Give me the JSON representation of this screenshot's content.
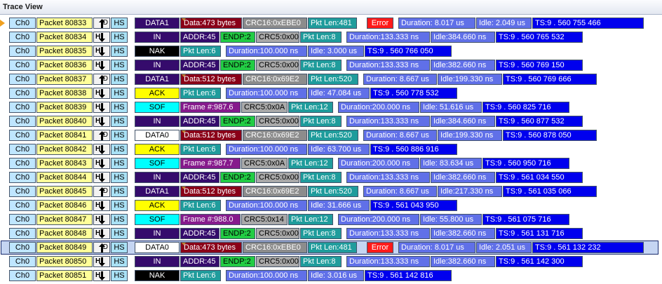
{
  "window": {
    "title": "Trace View"
  },
  "rows": [
    {
      "ch": "Ch0",
      "packet": "Packet 80833",
      "dir": "out",
      "dirLabel": "D",
      "hs": "HS",
      "pid": "DATA1",
      "pidType": "dark",
      "fields": [
        {
          "t": "dat",
          "text": "Data:473 bytes",
          "w": 88
        },
        {
          "t": "crc16",
          "text": "CRC16:0xEBE0",
          "w": 92
        },
        {
          "t": "plen",
          "text": "Pkt Len:481",
          "w": 70
        },
        {
          "t": "err",
          "text": "Error",
          "w": 38,
          "gap": 13
        },
        {
          "t": "dur",
          "text": "Duration:  8.017 us",
          "w": 110,
          "gap": 6
        },
        {
          "t": "idle",
          "text": "Idle:  2.049 us",
          "w": 79
        },
        {
          "t": "ts",
          "text": "TS:9 . 560 755 466",
          "w": 159
        }
      ]
    },
    {
      "ch": "Ch0",
      "packet": "Packet 80834",
      "dir": "in",
      "dirLabel": "H",
      "hs": "HS",
      "pid": "IN",
      "pidType": "dark",
      "fields": [
        {
          "t": "addr",
          "text": "ADDR:45",
          "w": 56
        },
        {
          "t": "endp",
          "text": "ENDP:2",
          "w": 50
        },
        {
          "t": "crc5",
          "text": "CRC5:0x00",
          "w": 62
        },
        {
          "t": "plen",
          "text": "Pkt Len:8",
          "w": 59
        },
        {
          "t": "dur",
          "text": "Duration:133.333 ns",
          "w": 119,
          "gap": 6
        },
        {
          "t": "idle",
          "text": "Idle:384.660 ns",
          "w": 92
        },
        {
          "t": "ts",
          "text": "TS:9 . 560 765 532",
          "w": 124
        }
      ]
    },
    {
      "ch": "Ch0",
      "packet": "Packet 80835",
      "dir": "in",
      "dirLabel": "H",
      "hs": "HS",
      "pid": "NAK",
      "pidType": "nak",
      "fields": [
        {
          "t": "plen",
          "text": "Pkt Len:6",
          "w": 58
        },
        {
          "t": "dur",
          "text": "Duration:100.000 ns",
          "w": 116,
          "gap": 6
        },
        {
          "t": "idle",
          "text": "Idle:  3.000 us",
          "w": 80
        },
        {
          "t": "ts",
          "text": "TS:9 . 560 766 050",
          "w": 124
        }
      ]
    },
    {
      "ch": "Ch0",
      "packet": "Packet 80836",
      "dir": "in",
      "dirLabel": "H",
      "hs": "HS",
      "pid": "IN",
      "pidType": "dark",
      "fields": [
        {
          "t": "addr",
          "text": "ADDR:45",
          "w": 56
        },
        {
          "t": "endp",
          "text": "ENDP:2",
          "w": 50
        },
        {
          "t": "crc5",
          "text": "CRC5:0x00",
          "w": 62
        },
        {
          "t": "plen",
          "text": "Pkt Len:8",
          "w": 59
        },
        {
          "t": "dur",
          "text": "Duration:133.333 ns",
          "w": 119,
          "gap": 6
        },
        {
          "t": "idle",
          "text": "Idle:382.660 ns",
          "w": 92
        },
        {
          "t": "ts",
          "text": "TS:9 . 560 769 150",
          "w": 124
        }
      ]
    },
    {
      "ch": "Ch0",
      "packet": "Packet 80837",
      "dir": "out",
      "dirLabel": "D",
      "hs": "HS",
      "pid": "DATA1",
      "pidType": "dark",
      "fields": [
        {
          "t": "dat",
          "text": "Data:512 bytes",
          "w": 88
        },
        {
          "t": "crc16",
          "text": "CRC16:0x69E2",
          "w": 92
        },
        {
          "t": "plen",
          "text": "Pkt Len:520",
          "w": 72
        },
        {
          "t": "dur",
          "text": "Duration:  8.667 us",
          "w": 105,
          "gap": 6
        },
        {
          "t": "idle",
          "text": "Idle:199.330 ns",
          "w": 92
        },
        {
          "t": "ts",
          "text": "TS:9 . 560 769 666",
          "w": 134
        }
      ]
    },
    {
      "ch": "Ch0",
      "packet": "Packet 80838",
      "dir": "in",
      "dirLabel": "H",
      "hs": "HS",
      "pid": "ACK",
      "pidType": "ack",
      "fields": [
        {
          "t": "plen",
          "text": "Pkt Len:6",
          "w": 58
        },
        {
          "t": "dur",
          "text": "Duration:100.000 ns",
          "w": 116,
          "gap": 6
        },
        {
          "t": "idle",
          "text": "Idle: 47.084 us",
          "w": 88
        },
        {
          "t": "ts",
          "text": "TS:9 . 560 778 532",
          "w": 124
        }
      ]
    },
    {
      "ch": "Ch0",
      "packet": "Packet 80839",
      "dir": "in",
      "dirLabel": "H",
      "hs": "HS",
      "pid": "SOF",
      "pidType": "sof",
      "fields": [
        {
          "t": "frame",
          "text": "Frame #:987.6",
          "w": 86
        },
        {
          "t": "crc5",
          "text": "CRC5:0x0A",
          "w": 66
        },
        {
          "t": "plen",
          "text": "Pkt Len:12",
          "w": 64
        },
        {
          "t": "dur",
          "text": "Duration:200.000 ns",
          "w": 116,
          "gap": 6
        },
        {
          "t": "idle",
          "text": "Idle: 51.616 us",
          "w": 88
        },
        {
          "t": "ts",
          "text": "TS:9 . 560 825 716",
          "w": 124
        }
      ]
    },
    {
      "ch": "Ch0",
      "packet": "Packet 80840",
      "dir": "in",
      "dirLabel": "H",
      "hs": "HS",
      "pid": "IN",
      "pidType": "dark",
      "fields": [
        {
          "t": "addr",
          "text": "ADDR:45",
          "w": 56
        },
        {
          "t": "endp",
          "text": "ENDP:2",
          "w": 50
        },
        {
          "t": "crc5",
          "text": "CRC5:0x00",
          "w": 62
        },
        {
          "t": "plen",
          "text": "Pkt Len:8",
          "w": 59
        },
        {
          "t": "dur",
          "text": "Duration:133.333 ns",
          "w": 119,
          "gap": 6
        },
        {
          "t": "idle",
          "text": "Idle:384.660 ns",
          "w": 92
        },
        {
          "t": "ts",
          "text": "TS:9 . 560 877 532",
          "w": 124
        }
      ]
    },
    {
      "ch": "Ch0",
      "packet": "Packet 80841",
      "dir": "out",
      "dirLabel": "D",
      "hs": "HS",
      "pid": "DATA0",
      "pidType": "data0",
      "fields": [
        {
          "t": "dat",
          "text": "Data:512 bytes",
          "w": 88
        },
        {
          "t": "crc16",
          "text": "CRC16:0x69E2",
          "w": 92
        },
        {
          "t": "plen",
          "text": "Pkt Len:520",
          "w": 72
        },
        {
          "t": "dur",
          "text": "Duration:  8.667 us",
          "w": 105,
          "gap": 6
        },
        {
          "t": "idle",
          "text": "Idle:199.330 ns",
          "w": 92
        },
        {
          "t": "ts",
          "text": "TS:9 . 560 878 050",
          "w": 134
        }
      ]
    },
    {
      "ch": "Ch0",
      "packet": "Packet 80842",
      "dir": "in",
      "dirLabel": "H",
      "hs": "HS",
      "pid": "ACK",
      "pidType": "ack",
      "fields": [
        {
          "t": "plen",
          "text": "Pkt Len:6",
          "w": 58
        },
        {
          "t": "dur",
          "text": "Duration:100.000 ns",
          "w": 116,
          "gap": 6
        },
        {
          "t": "idle",
          "text": "Idle: 63.700 us",
          "w": 88
        },
        {
          "t": "ts",
          "text": "TS:9 . 560 886 916",
          "w": 124
        }
      ]
    },
    {
      "ch": "Ch0",
      "packet": "Packet 80843",
      "dir": "in",
      "dirLabel": "H",
      "hs": "HS",
      "pid": "SOF",
      "pidType": "sof",
      "fields": [
        {
          "t": "frame",
          "text": "Frame #:987.7",
          "w": 86
        },
        {
          "t": "crc5",
          "text": "CRC5:0x0A",
          "w": 66
        },
        {
          "t": "plen",
          "text": "Pkt Len:12",
          "w": 64
        },
        {
          "t": "dur",
          "text": "Duration:200.000 ns",
          "w": 116,
          "gap": 6
        },
        {
          "t": "idle",
          "text": "Idle: 83.634 us",
          "w": 88
        },
        {
          "t": "ts",
          "text": "TS:9 . 560 950 716",
          "w": 124
        }
      ]
    },
    {
      "ch": "Ch0",
      "packet": "Packet 80844",
      "dir": "in",
      "dirLabel": "H",
      "hs": "HS",
      "pid": "IN",
      "pidType": "dark",
      "fields": [
        {
          "t": "addr",
          "text": "ADDR:45",
          "w": 56
        },
        {
          "t": "endp",
          "text": "ENDP:2",
          "w": 50
        },
        {
          "t": "crc5",
          "text": "CRC5:0x00",
          "w": 62
        },
        {
          "t": "plen",
          "text": "Pkt Len:8",
          "w": 59
        },
        {
          "t": "dur",
          "text": "Duration:133.333 ns",
          "w": 119,
          "gap": 6
        },
        {
          "t": "idle",
          "text": "Idle:382.660 ns",
          "w": 92
        },
        {
          "t": "ts",
          "text": "TS:9 . 561 034 550",
          "w": 124
        }
      ]
    },
    {
      "ch": "Ch0",
      "packet": "Packet 80845",
      "dir": "out",
      "dirLabel": "D",
      "hs": "HS",
      "pid": "DATA1",
      "pidType": "dark",
      "fields": [
        {
          "t": "dat",
          "text": "Data:512 bytes",
          "w": 88
        },
        {
          "t": "crc16",
          "text": "CRC16:0x69E2",
          "w": 92
        },
        {
          "t": "plen",
          "text": "Pkt Len:520",
          "w": 72
        },
        {
          "t": "dur",
          "text": "Duration:  8.667 us",
          "w": 105,
          "gap": 6
        },
        {
          "t": "idle",
          "text": "Idle:217.330 ns",
          "w": 92
        },
        {
          "t": "ts",
          "text": "TS:9 . 561 035 066",
          "w": 134
        }
      ]
    },
    {
      "ch": "Ch0",
      "packet": "Packet 80846",
      "dir": "in",
      "dirLabel": "H",
      "hs": "HS",
      "pid": "ACK",
      "pidType": "ack",
      "fields": [
        {
          "t": "plen",
          "text": "Pkt Len:6",
          "w": 58
        },
        {
          "t": "dur",
          "text": "Duration:100.000 ns",
          "w": 116,
          "gap": 6
        },
        {
          "t": "idle",
          "text": "Idle: 31.666 us",
          "w": 88
        },
        {
          "t": "ts",
          "text": "TS:9 . 561 043 950",
          "w": 124
        }
      ]
    },
    {
      "ch": "Ch0",
      "packet": "Packet 80847",
      "dir": "in",
      "dirLabel": "H",
      "hs": "HS",
      "pid": "SOF",
      "pidType": "sof",
      "fields": [
        {
          "t": "frame",
          "text": "Frame #:988.0",
          "w": 86
        },
        {
          "t": "crc5",
          "text": "CRC5:0x14",
          "w": 66
        },
        {
          "t": "plen",
          "text": "Pkt Len:12",
          "w": 64
        },
        {
          "t": "dur",
          "text": "Duration:200.000 ns",
          "w": 116,
          "gap": 6
        },
        {
          "t": "idle",
          "text": "Idle: 55.800 us",
          "w": 88
        },
        {
          "t": "ts",
          "text": "TS:9 . 561 075 716",
          "w": 124
        }
      ]
    },
    {
      "ch": "Ch0",
      "packet": "Packet 80848",
      "dir": "in",
      "dirLabel": "H",
      "hs": "HS",
      "pid": "IN",
      "pidType": "dark",
      "fields": [
        {
          "t": "addr",
          "text": "ADDR:45",
          "w": 56
        },
        {
          "t": "endp",
          "text": "ENDP:2",
          "w": 50
        },
        {
          "t": "crc5",
          "text": "CRC5:0x00",
          "w": 62
        },
        {
          "t": "plen",
          "text": "Pkt Len:8",
          "w": 59
        },
        {
          "t": "dur",
          "text": "Duration:133.333 ns",
          "w": 119,
          "gap": 6
        },
        {
          "t": "idle",
          "text": "Idle:382.660 ns",
          "w": 92
        },
        {
          "t": "ts",
          "text": "TS:9 . 561 131 716",
          "w": 124
        }
      ]
    },
    {
      "ch": "Ch0",
      "packet": "Packet 80849",
      "dir": "out",
      "dirLabel": "D",
      "hs": "HS",
      "pid": "DATA0",
      "pidType": "data0",
      "selected": true,
      "fields": [
        {
          "t": "dat",
          "text": "Data:473 bytes",
          "w": 88
        },
        {
          "t": "crc16",
          "text": "CRC16:0xEBE0",
          "w": 92
        },
        {
          "t": "plen",
          "text": "Pkt Len:481",
          "w": 70
        },
        {
          "t": "err",
          "text": "Error",
          "w": 38,
          "gap": 13
        },
        {
          "t": "dur",
          "text": "Duration:  8.017 us",
          "w": 110,
          "gap": 6
        },
        {
          "t": "idle",
          "text": "Idle:  2.051 us",
          "w": 79
        },
        {
          "t": "ts",
          "text": "TS:9 . 561 132 232",
          "w": 159
        }
      ]
    },
    {
      "ch": "Ch0",
      "packet": "Packet 80850",
      "dir": "in",
      "dirLabel": "H",
      "hs": "HS",
      "pid": "IN",
      "pidType": "dark",
      "fields": [
        {
          "t": "addr",
          "text": "ADDR:45",
          "w": 56
        },
        {
          "t": "endp",
          "text": "ENDP:2",
          "w": 50
        },
        {
          "t": "crc5",
          "text": "CRC5:0x00",
          "w": 62
        },
        {
          "t": "plen",
          "text": "Pkt Len:8",
          "w": 59
        },
        {
          "t": "dur",
          "text": "Duration:133.333 ns",
          "w": 119,
          "gap": 6
        },
        {
          "t": "idle",
          "text": "Idle:382.660 ns",
          "w": 92
        },
        {
          "t": "ts",
          "text": "TS:9 . 561 142 300",
          "w": 124
        }
      ]
    },
    {
      "ch": "Ch0",
      "packet": "Packet 80851",
      "dir": "in",
      "dirLabel": "H",
      "hs": "HS",
      "pid": "NAK",
      "pidType": "nak",
      "fields": [
        {
          "t": "plen",
          "text": "Pkt Len:6",
          "w": 58
        },
        {
          "t": "dur",
          "text": "Duration:100.000 ns",
          "w": 116,
          "gap": 6
        },
        {
          "t": "idle",
          "text": "Idle:  3.016 us",
          "w": 80
        },
        {
          "t": "ts",
          "text": "TS:9 . 561 142 816",
          "w": 124
        }
      ]
    }
  ]
}
